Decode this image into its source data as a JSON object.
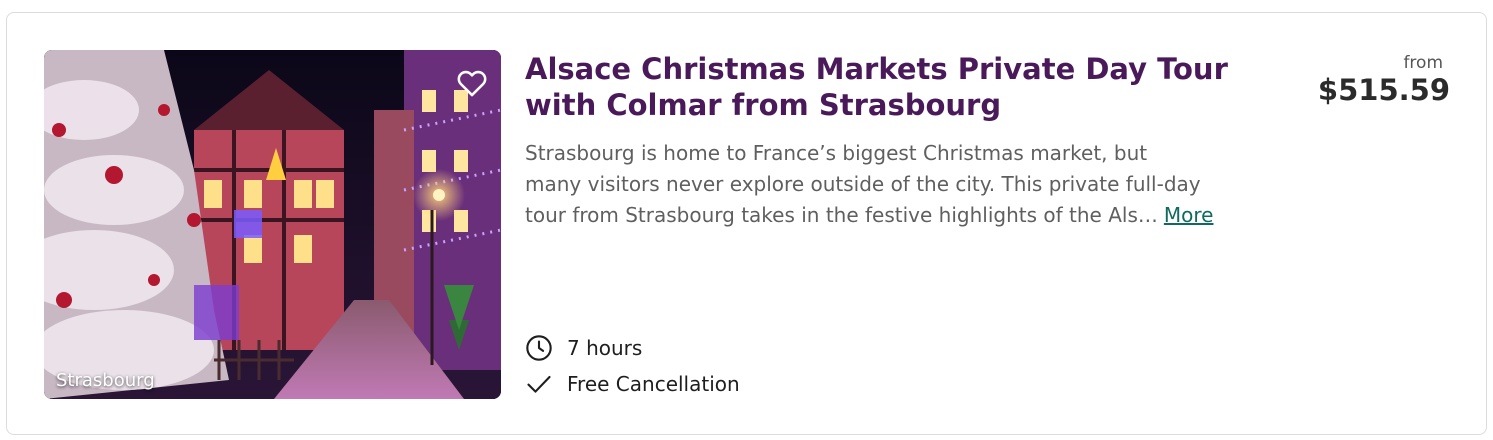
{
  "card": {
    "image": {
      "alt_subject": "christmas-market-street-scene",
      "location_label": "Strasbourg",
      "favorite_icon": "heart-outline-icon"
    },
    "title": "Alsace Christmas Markets Private Day Tour with Colmar from Strasbourg",
    "description": {
      "lines": [
        "Strasbourg is home to France’s biggest Christmas market, but",
        "many visitors never explore outside of the city. This private full-day",
        "tour from Strasbourg takes in the festive highlights of the Als…"
      ],
      "more_label": "More"
    },
    "price": {
      "prefix": "from",
      "amount": "$515.59"
    },
    "features": [
      {
        "icon": "clock-icon",
        "label": "7 hours"
      },
      {
        "icon": "checkmark-icon",
        "label": "Free Cancellation"
      }
    ],
    "colors": {
      "title": "#4a1959",
      "link": "#0f6b5f",
      "text": "#5f5f5f",
      "border": "#dcdcdc"
    }
  }
}
